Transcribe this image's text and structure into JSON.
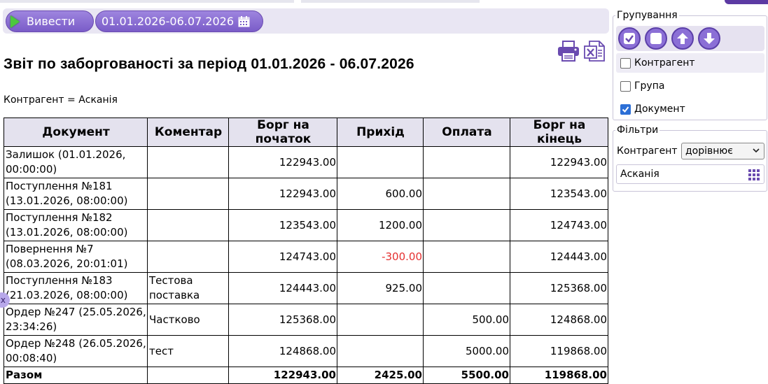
{
  "toolbar": {
    "run_label": "Вивести",
    "period_label": "01.01.2026-06.07.2026"
  },
  "report": {
    "title": "Звіт по заборгованості за період 01.01.2026 - 06.07.2026",
    "filter_line": "Контрагент = Асканія",
    "columns": [
      "Документ",
      "Коментар",
      "Борг на початок",
      "Прихід",
      "Оплата",
      "Борг на кінець"
    ],
    "rows": [
      {
        "doc1": "Залишок (01.01.2026,",
        "doc2": "00:00:00)",
        "comment1": "",
        "comment2": "",
        "start": "122943.00",
        "income": "",
        "payment": "",
        "end": "122943.00"
      },
      {
        "doc1": "Поступлення №181",
        "doc2": "(13.01.2026, 08:00:00)",
        "comment1": "",
        "comment2": "",
        "start": "122943.00",
        "income": "600.00",
        "payment": "",
        "end": "123543.00"
      },
      {
        "doc1": "Поступлення №182",
        "doc2": "(13.01.2026, 08:00:00)",
        "comment1": "",
        "comment2": "",
        "start": "123543.00",
        "income": "1200.00",
        "payment": "",
        "end": "124743.00"
      },
      {
        "doc1": "Повернення №7",
        "doc2": "(08.03.2026, 20:01:01)",
        "comment1": "",
        "comment2": "",
        "start": "124743.00",
        "income": "-300.00",
        "payment": "",
        "end": "124443.00"
      },
      {
        "doc1": "Поступлення №183",
        "doc2": "(21.03.2026, 08:00:00)",
        "comment1": "Тестова",
        "comment2": "поставка",
        "start": "124443.00",
        "income": "925.00",
        "payment": "",
        "end": "125368.00"
      },
      {
        "doc1": "Ордер №247 (25.05.2026,",
        "doc2": "23:34:26)",
        "comment1": "Частково",
        "comment2": "",
        "start": "125368.00",
        "income": "",
        "payment": "500.00",
        "end": "124868.00"
      },
      {
        "doc1": "Ордер №248 (26.05.2026,",
        "doc2": "00:08:40)",
        "comment1": "тест",
        "comment2": "",
        "start": "124868.00",
        "income": "",
        "payment": "5000.00",
        "end": "119868.00"
      }
    ],
    "total": {
      "label": "Разом",
      "comment": "",
      "start": "122943.00",
      "income": "2425.00",
      "payment": "5500.00",
      "end": "119868.00"
    },
    "negative_color": "#e53030"
  },
  "side_handle": "x",
  "grouping": {
    "legend": "Групування",
    "options": [
      {
        "label": "Контрагент",
        "checked": false
      },
      {
        "label": "Група",
        "checked": false
      },
      {
        "label": "Документ",
        "checked": true
      }
    ]
  },
  "filters": {
    "legend": "Фільтри",
    "field_label": "Контрагент",
    "operator": "дорівнює",
    "value": "Асканія"
  },
  "colors": {
    "accent": "#7a5cc8",
    "header_bg": "#e4e2ee"
  }
}
